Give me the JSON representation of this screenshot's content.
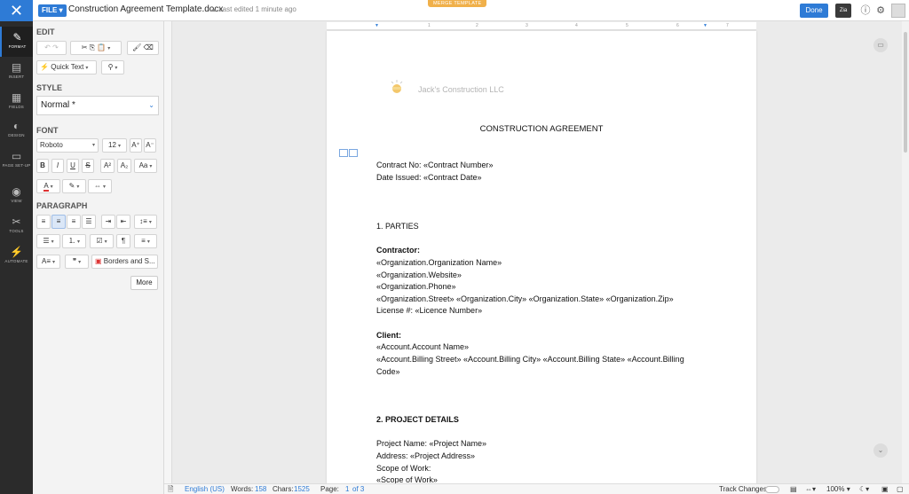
{
  "topbar": {
    "close_icon": "x-icon",
    "file_label": "FILE",
    "doc_title": "Construction Agreement Template.docx",
    "last_edited": "Last edited 1 minute ago",
    "merge_badge": "MERGE TEMPLATE",
    "done_label": "Done",
    "zia_label": "Zia"
  },
  "leftnav": {
    "items": [
      {
        "label": "FORMAT",
        "icon": "pen-icon"
      },
      {
        "label": "INSERT",
        "icon": "insert-icon"
      },
      {
        "label": "FIELDS",
        "icon": "fields-icon"
      },
      {
        "label": "DESIGN",
        "icon": "design-icon"
      },
      {
        "label": "PAGE SET-UP",
        "icon": "page-setup-icon"
      },
      {
        "label": "VIEW",
        "icon": "eye-icon"
      },
      {
        "label": "TOOLS",
        "icon": "tools-icon"
      },
      {
        "label": "AUTOMATE",
        "icon": "automate-icon"
      }
    ]
  },
  "panel": {
    "edit_title": "EDIT",
    "quick_text": "Quick Text",
    "style_title": "STYLE",
    "style_value": "Normal *",
    "font_title": "FONT",
    "font_family": "Roboto",
    "font_size": "12",
    "paragraph_title": "PARAGRAPH",
    "borders_label": "Borders and S...",
    "more_label": "More"
  },
  "ruler": {
    "marks": [
      "1",
      "1",
      "2",
      "3",
      "4",
      "5",
      "6",
      "7"
    ]
  },
  "document": {
    "company": "Jack's Construction LLC",
    "heading": "CONSTRUCTION AGREEMENT",
    "lines": [
      {
        "text": "Contract No: «Contract Number»",
        "bold": false
      },
      {
        "text": "Date Issued: «Contract Date»",
        "bold": false
      },
      {
        "text": "1. PARTIES",
        "bold": false
      },
      {
        "text": "Contractor:",
        "bold": true
      },
      {
        "text": "«Organization.Organization Name»",
        "bold": false
      },
      {
        "text": "«Organization.Website»",
        "bold": false
      },
      {
        "text": "«Organization.Phone»",
        "bold": false
      },
      {
        "text": "«Organization.Street» «Organization.City» «Organization.State» «Organization.Zip»",
        "bold": false
      },
      {
        "text": "License #: «Licence Number»",
        "bold": false
      },
      {
        "text": "Client:",
        "bold": true
      },
      {
        "text": "«Account.Account Name»",
        "bold": false
      },
      {
        "text": "«Account.Billing Street» «Account.Billing City» «Account.Billing State» «Account.Billing",
        "bold": false
      },
      {
        "text": "Code»",
        "bold": false
      },
      {
        "text": "2. PROJECT DETAILS",
        "bold": true
      },
      {
        "text": "Project Name:  «Project Name»",
        "bold": false
      },
      {
        "text": "Address: «Project Address»",
        "bold": false
      },
      {
        "text": "Scope of Work:",
        "bold": false
      },
      {
        "text": "«Scope of Work»",
        "bold": false
      }
    ]
  },
  "status": {
    "language": "English (US)",
    "words_label": "Words:",
    "words": "158",
    "chars_label": "Chars:",
    "chars": "1525",
    "page_label": "Page:",
    "page_current": "1",
    "page_total": "of 3",
    "track_changes": "Track Changes",
    "zoom": "100%"
  }
}
